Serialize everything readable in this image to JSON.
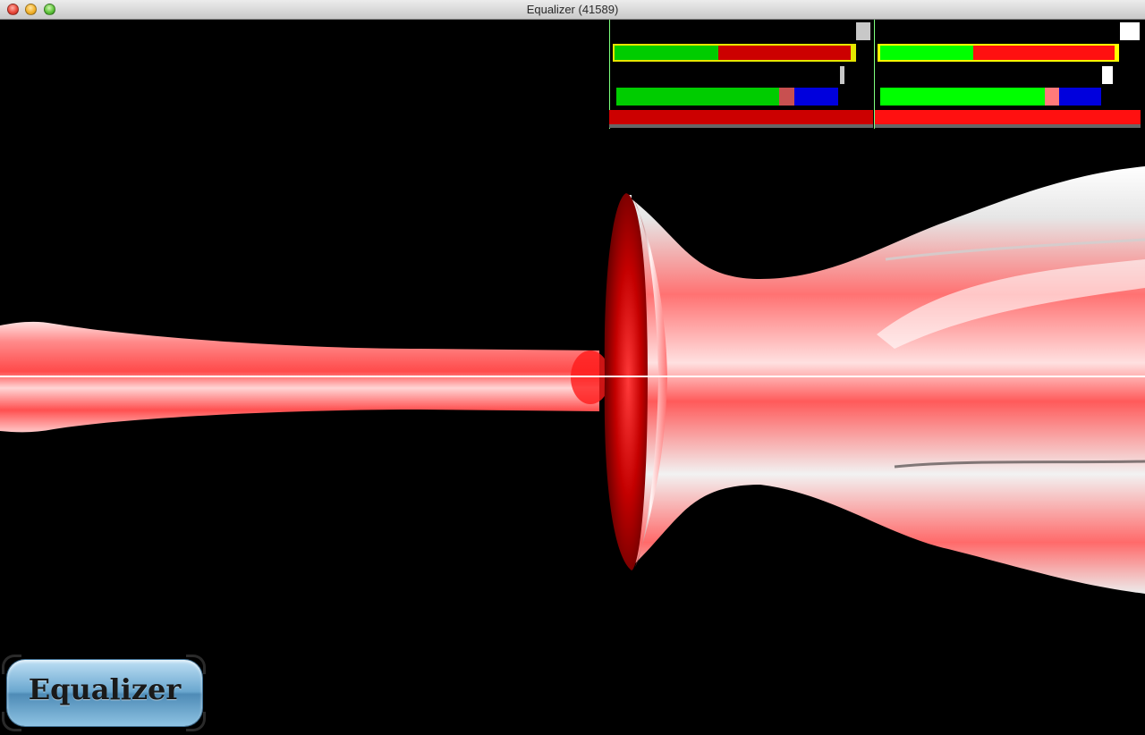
{
  "window": {
    "title": "Equalizer (41589)"
  },
  "logo": {
    "text": "Equalizer"
  },
  "colors": {
    "stats_green_dark": "#00cc00",
    "stats_green_light": "#00ff00",
    "stats_red": "#cc0000",
    "stats_red_bright": "#ff1010",
    "stats_yellow": "#ffff00",
    "stats_blue": "#0000dd",
    "stats_salmon": "#e86060",
    "model_red": "#ff3030",
    "model_dark_red": "#7a0000"
  }
}
